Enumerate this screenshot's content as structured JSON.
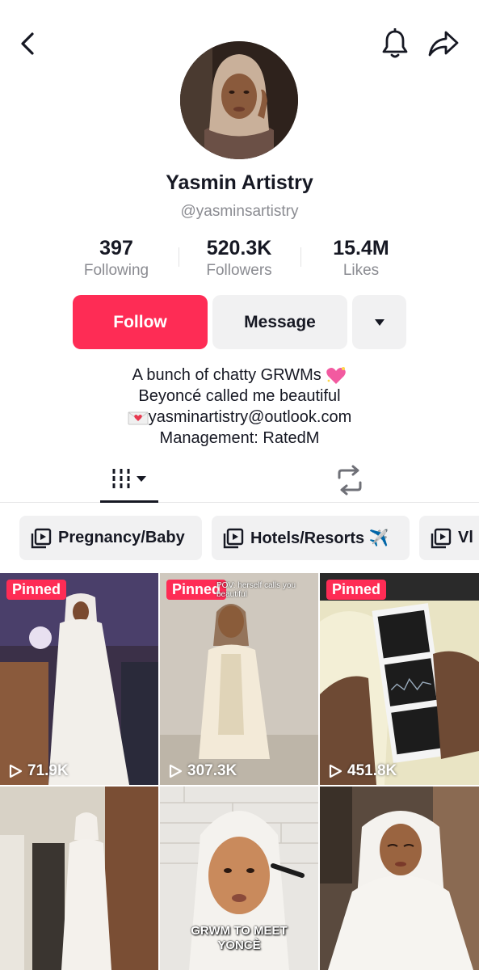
{
  "header": {
    "back_icon": "chevron-left-icon",
    "bell_icon": "bell-icon",
    "share_icon": "share-arrow-icon"
  },
  "profile": {
    "display_name": "Yasmin Artistry",
    "username": "@yasminsartistry",
    "stats": [
      {
        "value": "397",
        "label": "Following"
      },
      {
        "value": "520.3K",
        "label": "Followers"
      },
      {
        "value": "15.4M",
        "label": "Likes"
      }
    ],
    "follow_label": "Follow",
    "message_label": "Message",
    "bio": [
      "A bunch of chatty GRWMs",
      "Beyoncé called me beautiful",
      "yasminartistry@outlook.com",
      "Management: RatedM"
    ]
  },
  "tabs": {
    "videos_icon": "grid-bars-icon",
    "repost_icon": "repost-icon"
  },
  "playlists": [
    {
      "label": "Pregnancy/Baby"
    },
    {
      "label": "Hotels/Resorts ✈️"
    },
    {
      "label": "Vl"
    }
  ],
  "videos": [
    {
      "pinned": "Pinned",
      "views": "71.9K"
    },
    {
      "pinned": "Pinned",
      "views": "307.3K",
      "caption": "POV: herself calls you beautiful"
    },
    {
      "pinned": "Pinned",
      "views": "451.8K"
    },
    {},
    {
      "caption": "GRWM TO MEET YONCÈ"
    },
    {}
  ],
  "colors": {
    "accent": "#fe2c55",
    "button_gray": "#f1f1f2",
    "text_primary": "#161823",
    "text_secondary": "#8a8b91"
  }
}
